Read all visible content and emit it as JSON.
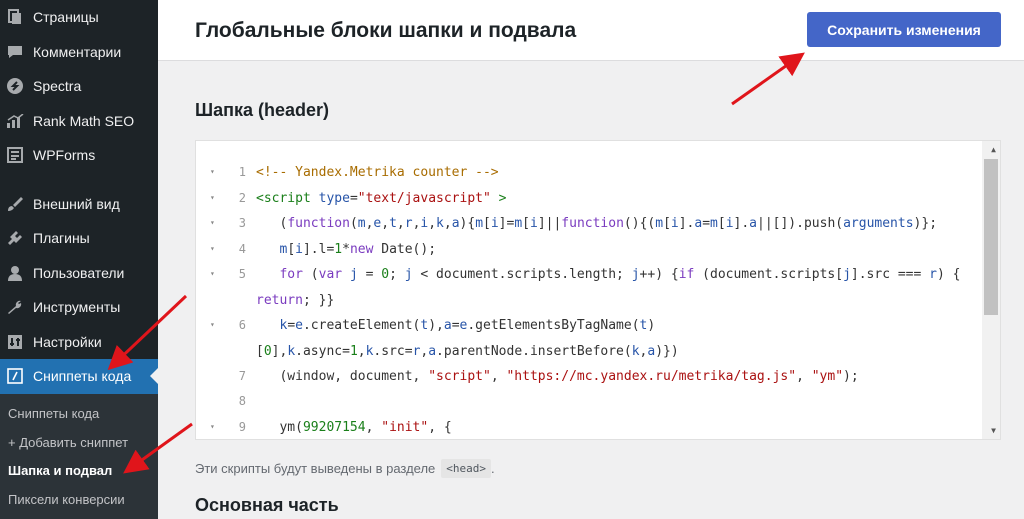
{
  "sidebar": {
    "items": [
      {
        "label": "Страницы",
        "icon": "pages-icon"
      },
      {
        "label": "Комментарии",
        "icon": "comments-icon"
      },
      {
        "label": "Spectra",
        "icon": "spectra-icon"
      },
      {
        "label": "Rank Math SEO",
        "icon": "rankmath-icon"
      },
      {
        "label": "WPForms",
        "icon": "wpforms-icon"
      },
      {
        "label": "Внешний вид",
        "icon": "appearance-icon"
      },
      {
        "label": "Плагины",
        "icon": "plugins-icon"
      },
      {
        "label": "Пользователи",
        "icon": "users-icon"
      },
      {
        "label": "Инструменты",
        "icon": "tools-icon"
      },
      {
        "label": "Настройки",
        "icon": "settings-icon"
      },
      {
        "label": "Сниппеты кода",
        "icon": "snippets-icon"
      }
    ],
    "submenu": [
      {
        "label": "Сниппеты кода"
      },
      {
        "label": "+ Добавить сниппет"
      },
      {
        "label": "Шапка и подвал"
      },
      {
        "label": "Пиксели конверсии"
      }
    ]
  },
  "header": {
    "title": "Глобальные блоки шапки и подвала",
    "save_label": "Сохранить изменения"
  },
  "header_section": {
    "title": "Шапка (header)",
    "note": "Эти скрипты будут выведены в разделе",
    "note_code": "<head>",
    "note_end": "."
  },
  "body_section": {
    "title": "Основная часть"
  },
  "editor": {
    "line_numbers": [
      "1",
      "2",
      "3",
      "4",
      "5",
      "",
      "6",
      "",
      "7",
      "8",
      "9"
    ],
    "folds": [
      "▾",
      "▾",
      "▾",
      "▾",
      "▾",
      "",
      "▾",
      "",
      "",
      "",
      "▾"
    ]
  },
  "colors": {
    "accent": "#2271b1",
    "save_button": "#4466c8",
    "arrow": "#e0151b",
    "sidebar_bg": "#1d2327"
  }
}
